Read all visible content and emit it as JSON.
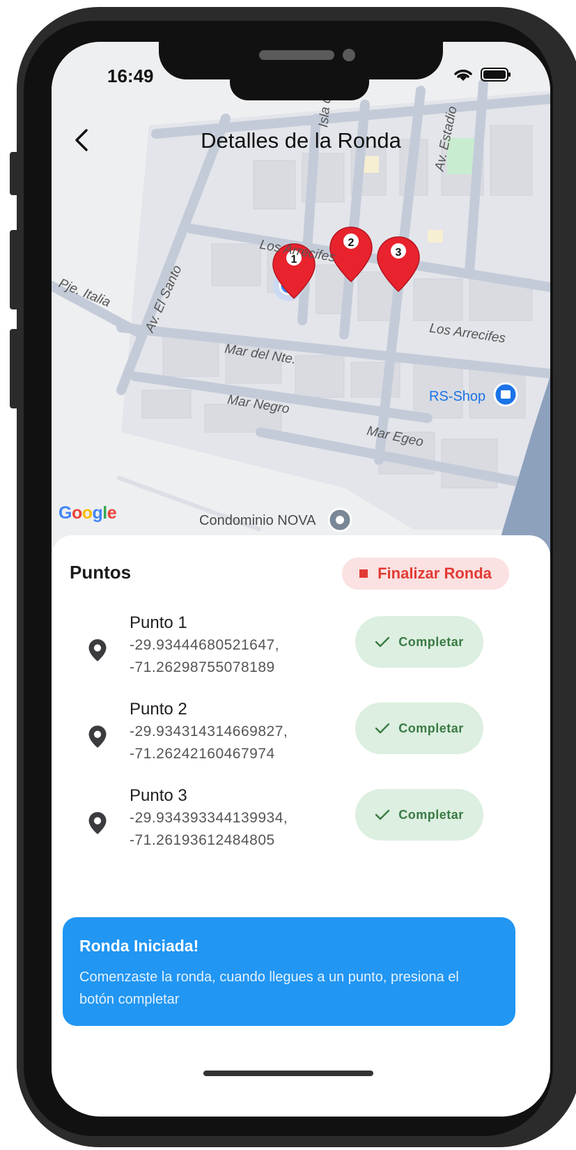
{
  "status_bar": {
    "time": "16:49"
  },
  "header": {
    "title": "Detalles de la Ronda"
  },
  "map": {
    "brand": "Google",
    "streets": [
      {
        "id": "arrecifes-1",
        "name": "Los Arrecifes"
      },
      {
        "id": "arrecifes-2",
        "name": "Los Arrecifes"
      },
      {
        "id": "pje-italia",
        "name": "Pje. Italia"
      },
      {
        "id": "av-el-santo",
        "name": "Av. El Santo"
      },
      {
        "id": "mar-del-nte",
        "name": "Mar del Nte."
      },
      {
        "id": "mar-negro",
        "name": "Mar Negro"
      },
      {
        "id": "mar-egeo",
        "name": "Mar Egeo"
      },
      {
        "id": "av-estadio",
        "name": "Av. Estadio"
      },
      {
        "id": "isla-de",
        "name": "Isla de"
      }
    ],
    "pois": [
      {
        "id": "rs-shop",
        "name": "RS-Shop"
      },
      {
        "id": "condominio",
        "name": "Condominio NOVA"
      }
    ],
    "markers": [
      "1",
      "2",
      "3"
    ],
    "colors": {
      "marker": "#e8232e",
      "user_location": "#4285f4"
    }
  },
  "panel": {
    "title": "Puntos",
    "finish_label": "Finalizar Ronda",
    "complete_label": "Completar",
    "points": [
      {
        "name": "Punto 1",
        "lat": "-29.93444680521647,",
        "lng": "-71.26298755078189"
      },
      {
        "name": "Punto 2",
        "lat": "-29.934314314669827,",
        "lng": "-71.26242160467974"
      },
      {
        "name": "Punto 3",
        "lat": "-29.934393344139934,",
        "lng": "-71.26193612484805"
      }
    ]
  },
  "toast": {
    "title": "Ronda Iniciada!",
    "message": "Comenzaste la ronda, cuando llegues a un punto, presiona el botón completar"
  },
  "colors": {
    "finish_bg": "#fbe1e1",
    "finish_fg": "#e23a35",
    "complete_bg": "#dcefe0",
    "complete_fg": "#3a7a44",
    "toast_bg": "#2196f3"
  }
}
